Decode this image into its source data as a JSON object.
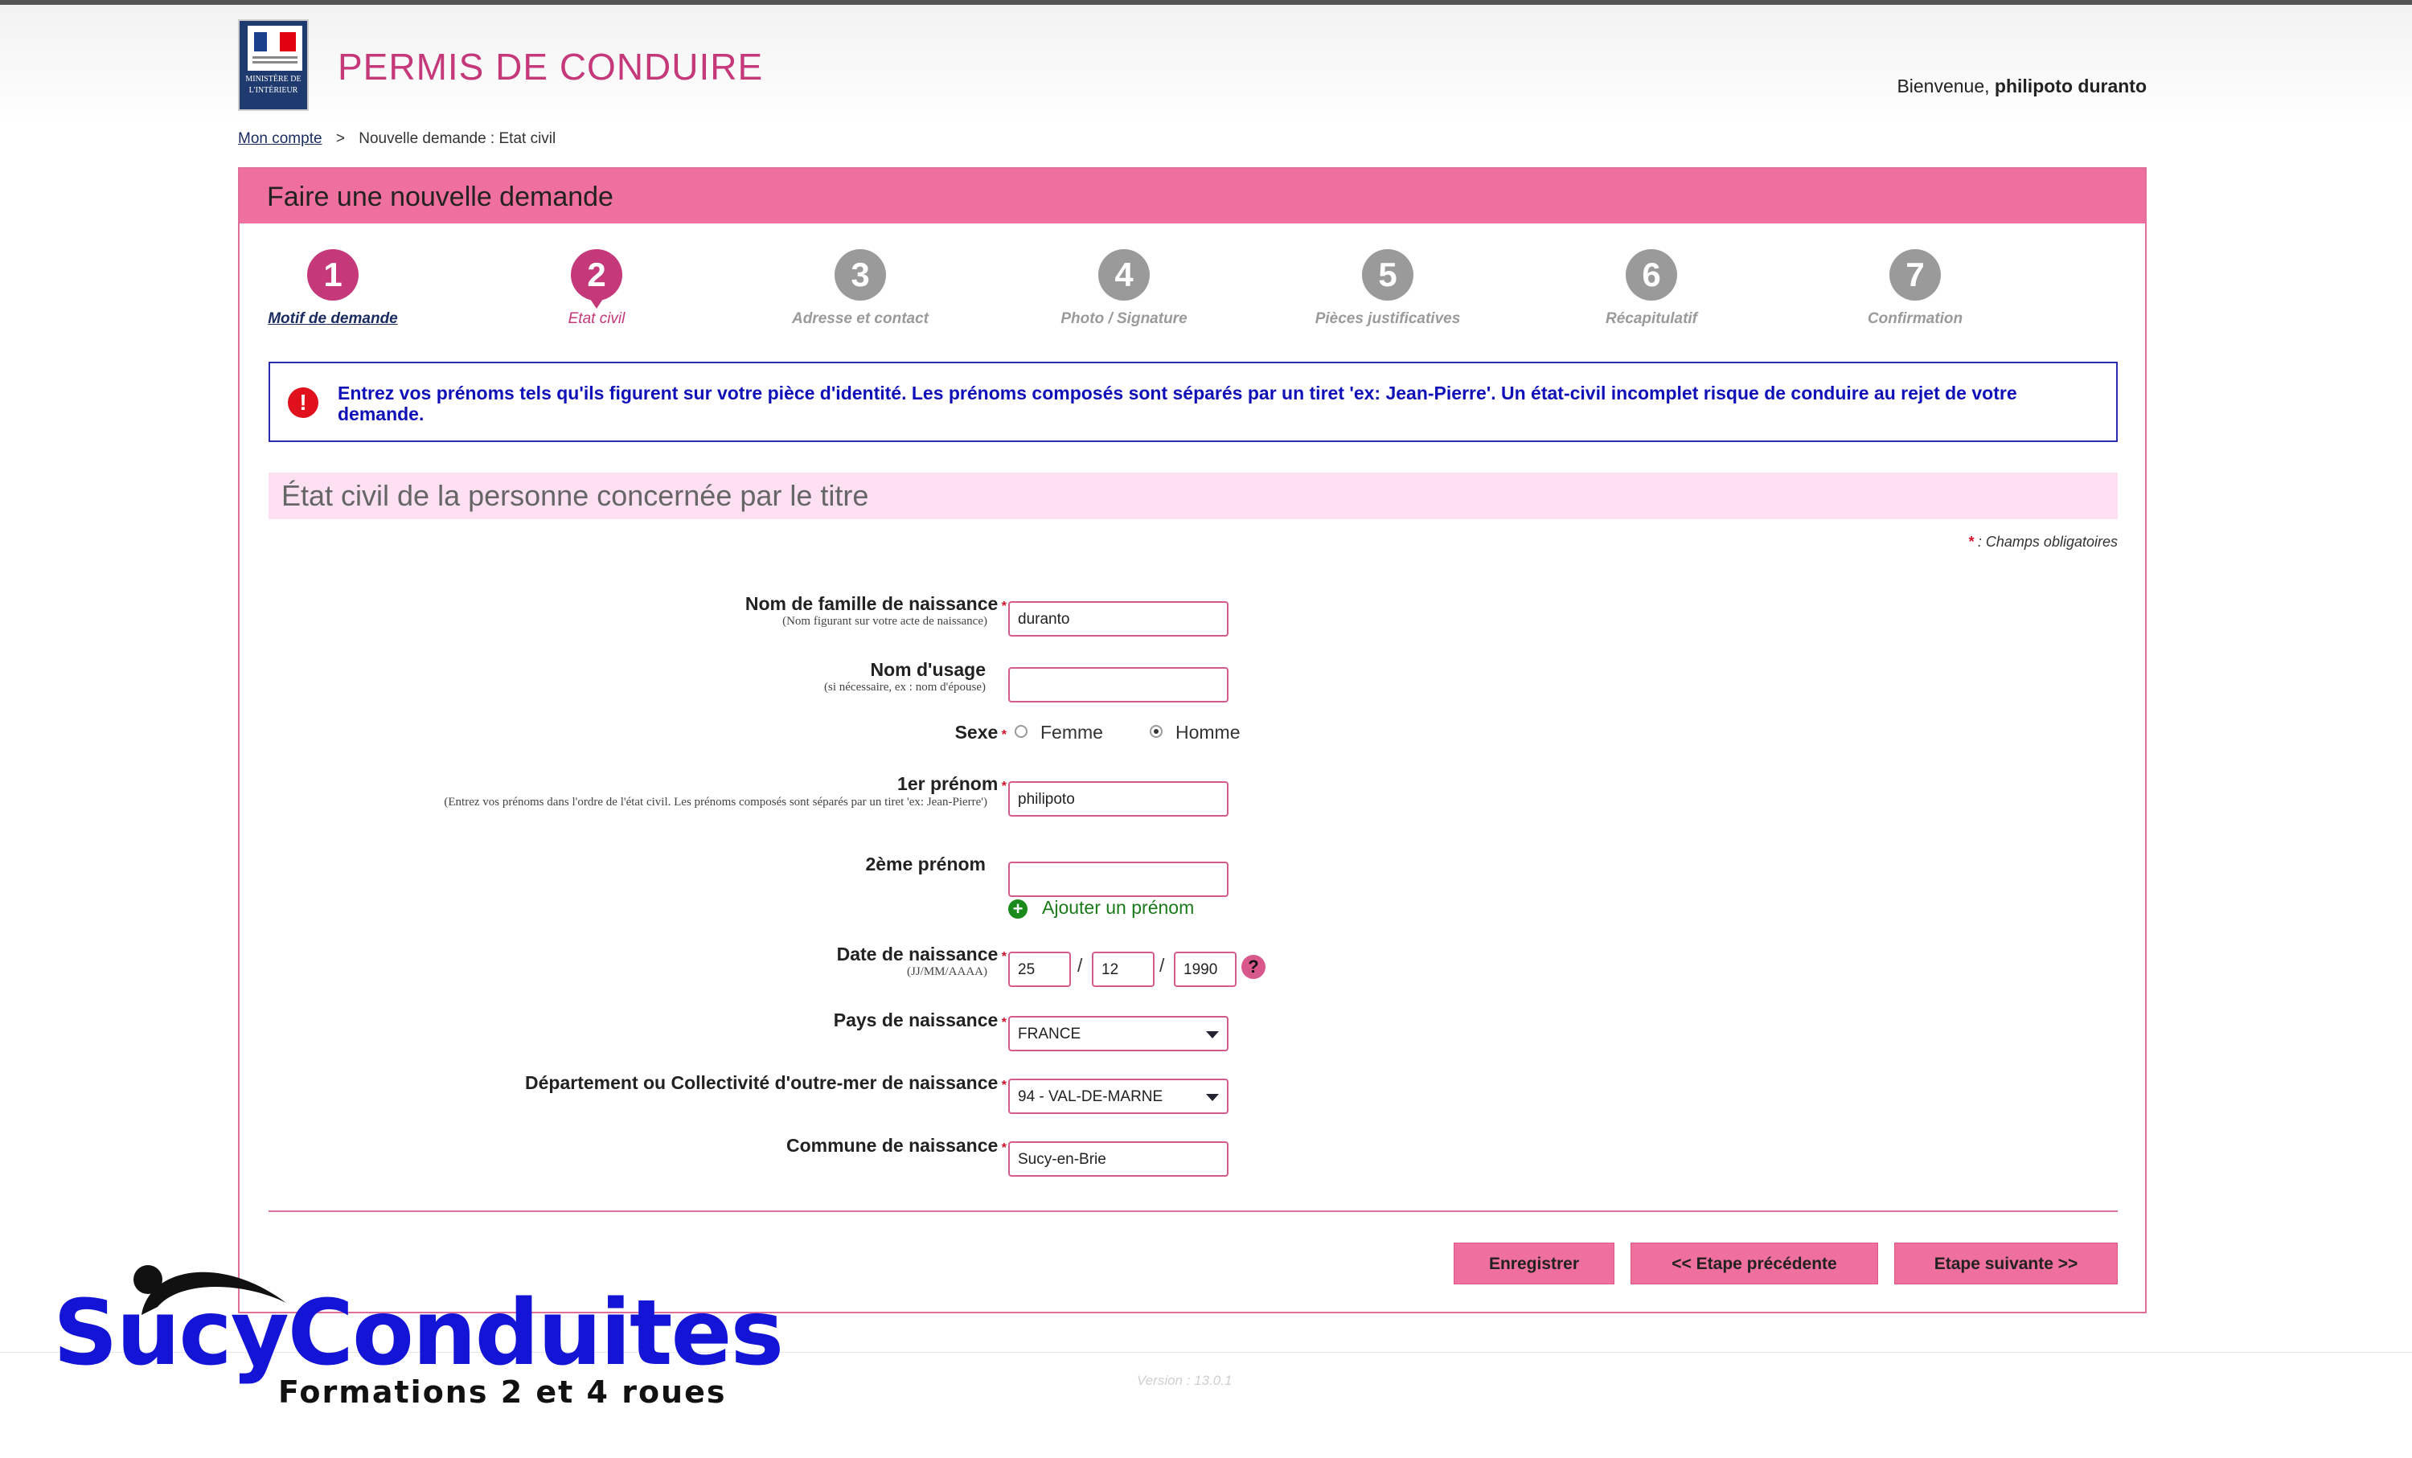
{
  "header": {
    "logo_text": "MINISTÈRE DE L'INTÉRIEUR",
    "app_title": "PERMIS DE CONDUIRE",
    "welcome_prefix": "Bienvenue,",
    "user_name": "philipoto duranto"
  },
  "breadcrumb": {
    "account_link": "Mon compte",
    "separator": ">",
    "current": "Nouvelle demande : Etat civil"
  },
  "panel": {
    "title": "Faire une nouvelle demande"
  },
  "steps": [
    {
      "num": "1",
      "label": "Motif de demande",
      "state": "done"
    },
    {
      "num": "2",
      "label": "Etat civil",
      "state": "active"
    },
    {
      "num": "3",
      "label": "Adresse et contact",
      "state": "todo"
    },
    {
      "num": "4",
      "label": "Photo / Signature",
      "state": "todo"
    },
    {
      "num": "5",
      "label": "Pièces justificatives",
      "state": "todo"
    },
    {
      "num": "6",
      "label": "Récapitulatif",
      "state": "todo"
    },
    {
      "num": "7",
      "label": "Confirmation",
      "state": "todo"
    }
  ],
  "alert": {
    "icon": "!",
    "text": "Entrez vos prénoms tels qu'ils figurent sur votre pièce d'identité. Les prénoms composés sont séparés par un tiret 'ex: Jean-Pierre'. Un état-civil incomplet risque de conduire au rejet de votre demande."
  },
  "section": {
    "title": "État civil de la personne concernée par le titre",
    "mandatory_star": "*",
    "mandatory_note": ": Champs obligatoires"
  },
  "form": {
    "required_marker": "*",
    "nom_famille": {
      "label": "Nom de famille de naissance",
      "hint": "(Nom figurant sur votre acte de naissance)",
      "value": "duranto"
    },
    "nom_usage": {
      "label": "Nom d'usage",
      "hint": "(si nécessaire, ex : nom d'épouse)",
      "value": ""
    },
    "sexe": {
      "label": "Sexe",
      "option_f": "Femme",
      "option_h": "Homme",
      "selected": "Homme"
    },
    "prenom1": {
      "label": "1er prénom",
      "hint": "(Entrez vos prénoms dans l'ordre de l'état civil. Les prénoms composés sont séparés par un tiret 'ex: Jean-Pierre')",
      "value": "philipoto"
    },
    "prenom2": {
      "label": "2ème prénom",
      "value": ""
    },
    "add_prenom": "Ajouter un prénom",
    "date_naissance": {
      "label": "Date de naissance",
      "hint": "(JJ/MM/AAAA)",
      "day": "25",
      "month": "12",
      "year": "1990",
      "sep": "/",
      "help": "?"
    },
    "pays": {
      "label": "Pays de naissance",
      "value": "FRANCE"
    },
    "departement": {
      "label": "Département ou Collectivité d'outre-mer de naissance",
      "value": "94 - VAL-DE-MARNE"
    },
    "commune": {
      "label": "Commune de naissance",
      "value": "Sucy-en-Brie"
    }
  },
  "buttons": {
    "save": "Enregistrer",
    "prev": "<<  Etape précédente",
    "next": "Etape suivante  >>"
  },
  "footer": {
    "version": "Version : 13.0.1"
  },
  "watermark": {
    "brand": "SucyConduites",
    "tagline": "Formations 2 et 4 roues"
  }
}
